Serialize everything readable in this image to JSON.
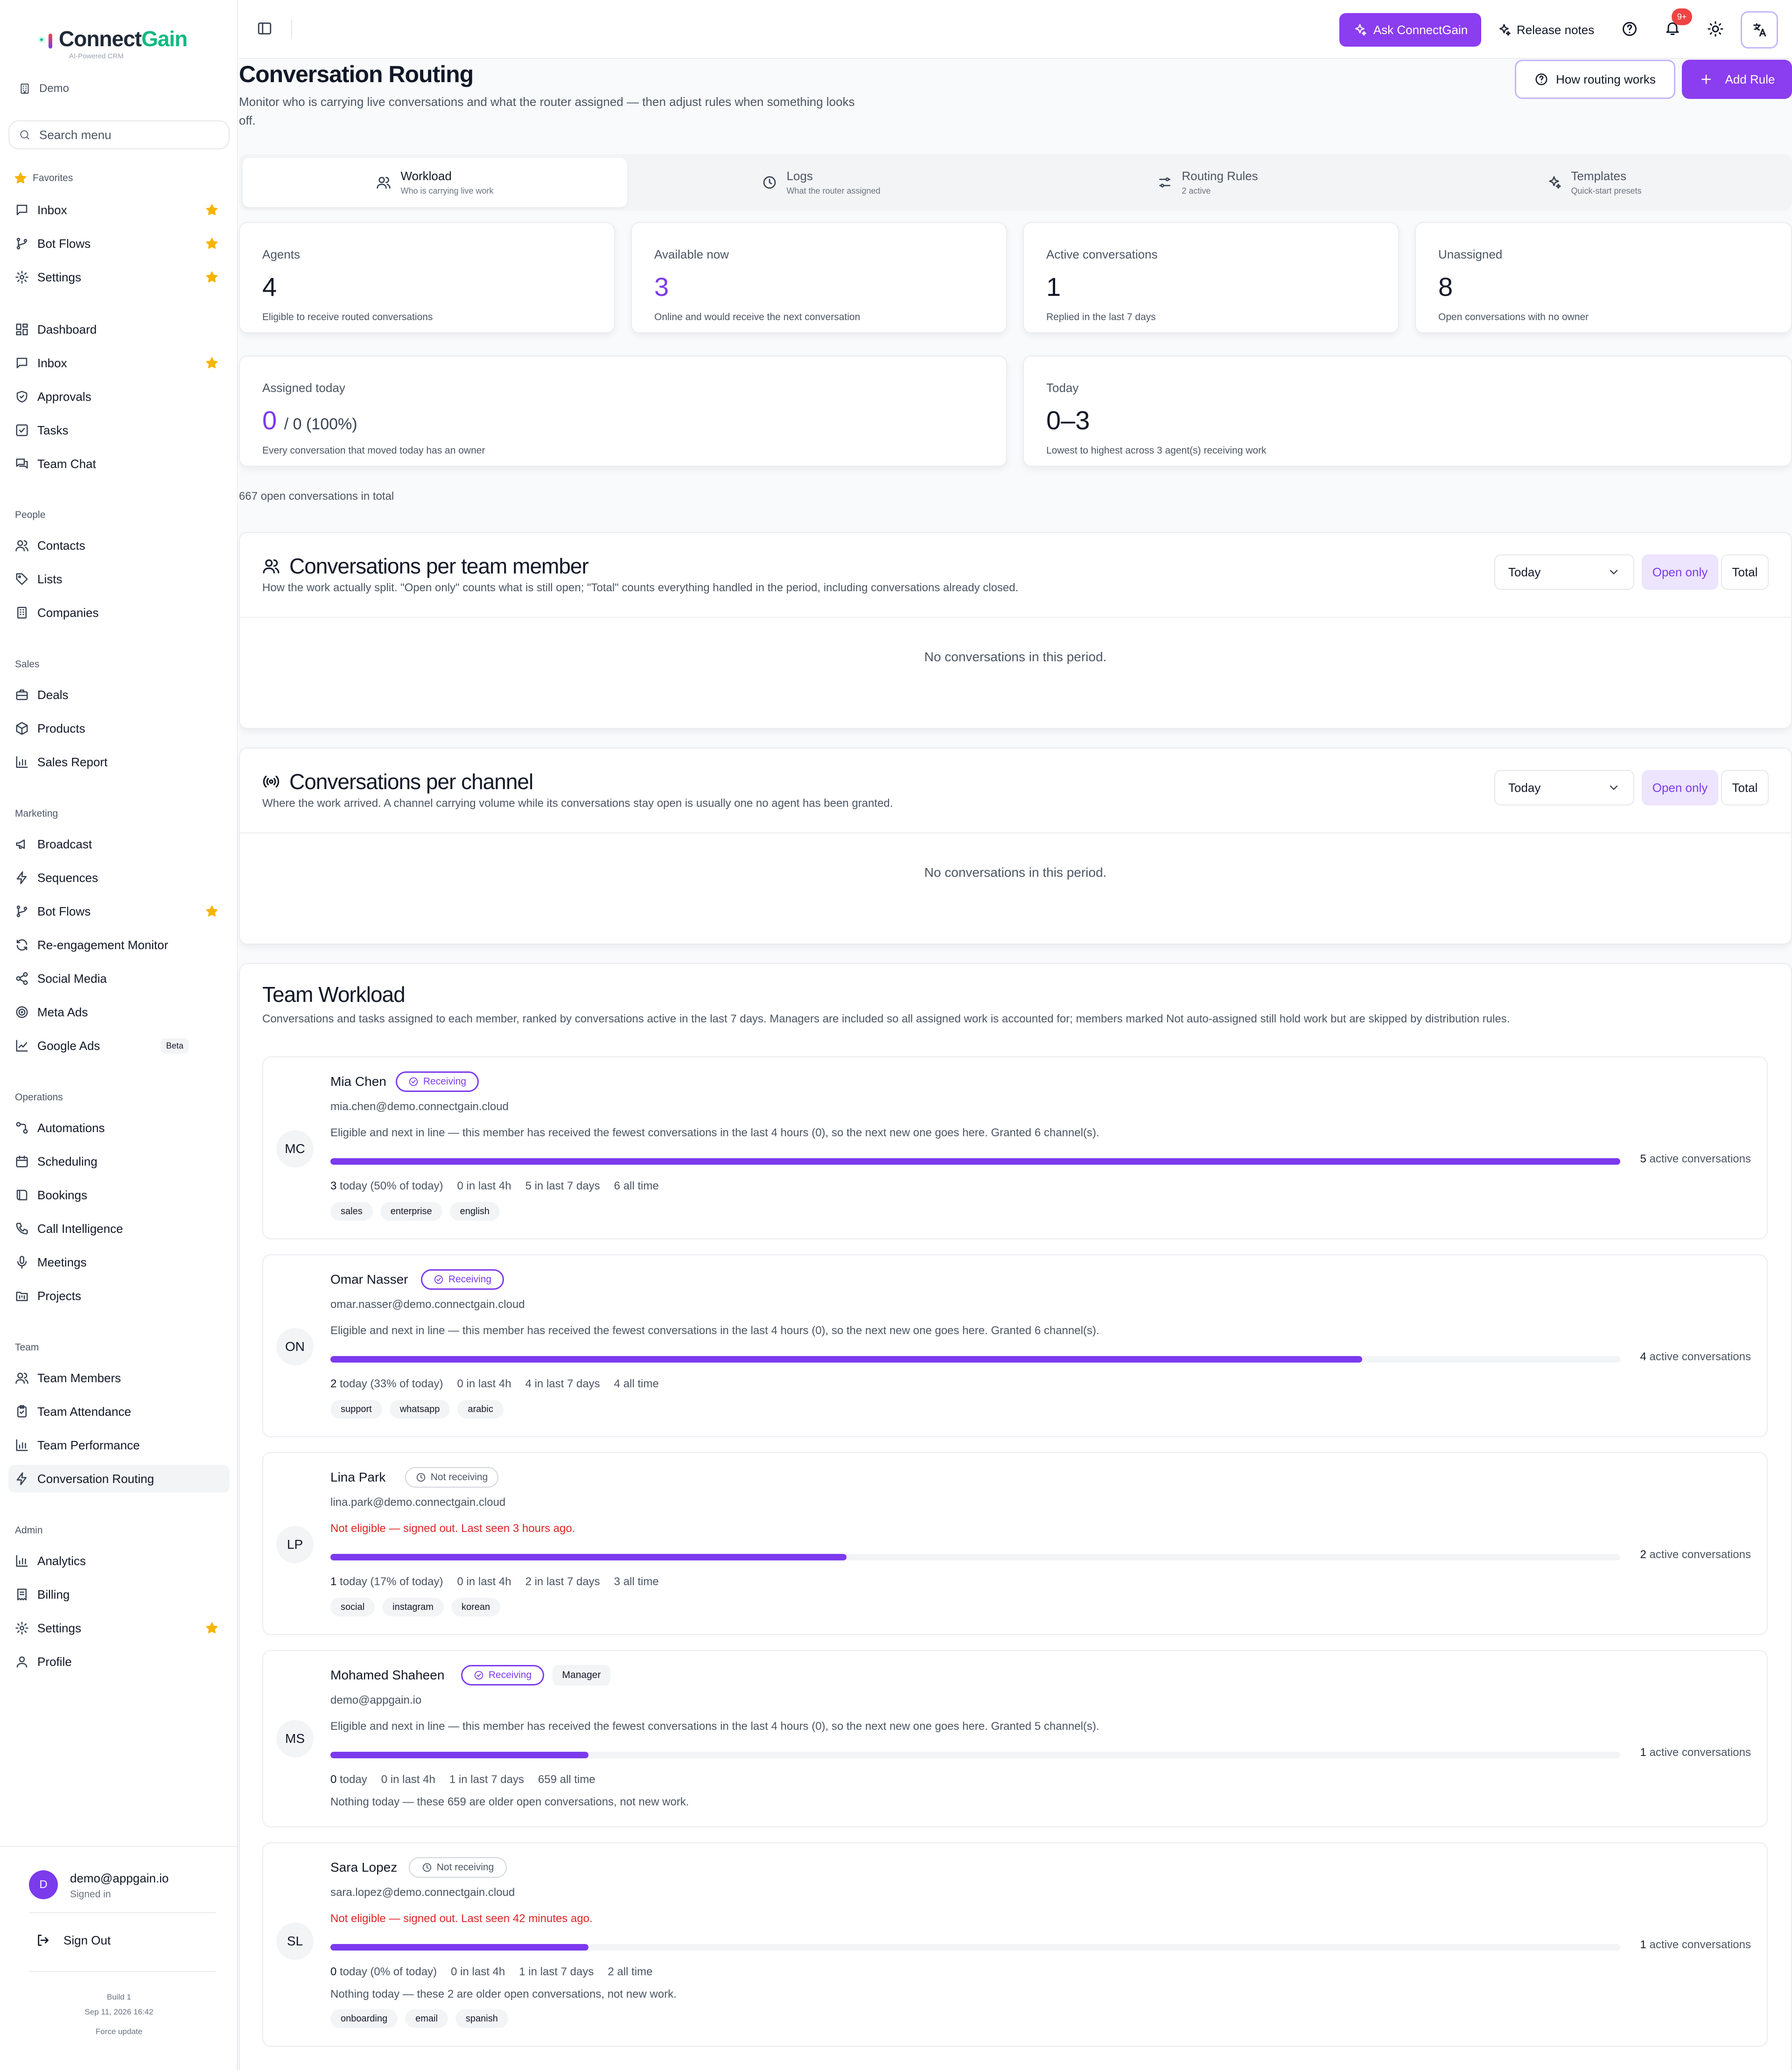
{
  "brand": {
    "name_a": "Connect",
    "name_b": "Gain",
    "tagline": "AI-Powered CRM"
  },
  "workspace": {
    "label": "Demo"
  },
  "search": {
    "placeholder": "Search menu"
  },
  "sidebar": {
    "favorites_label": "Favorites",
    "favorites": [
      "Inbox",
      "Bot Flows",
      "Settings"
    ],
    "main": [
      "Dashboard",
      "Inbox",
      "Approvals",
      "Tasks",
      "Team Chat"
    ],
    "people_label": "People",
    "people": [
      "Contacts",
      "Lists",
      "Companies"
    ],
    "sales_label": "Sales",
    "sales": [
      "Deals",
      "Products",
      "Sales Report"
    ],
    "marketing_label": "Marketing",
    "marketing": [
      "Broadcast",
      "Sequences",
      "Bot Flows",
      "Re-engagement Monitor",
      "Social Media",
      "Meta Ads",
      "Google Ads"
    ],
    "beta_label": "Beta",
    "operations_label": "Operations",
    "operations": [
      "Automations",
      "Scheduling",
      "Bookings",
      "Call Intelligence",
      "Meetings",
      "Projects"
    ],
    "team_label": "Team",
    "team": [
      "Team Members",
      "Team Attendance",
      "Team Performance",
      "Conversation Routing"
    ],
    "admin_label": "Admin",
    "admin": [
      "Analytics",
      "Billing",
      "Settings",
      "Profile"
    ]
  },
  "user": {
    "initial": "D",
    "email": "demo@appgain.io",
    "status": "Signed in",
    "sign_out": "Sign Out"
  },
  "build": {
    "label": "Build 1",
    "date": "Sep 11, 2026 16:42",
    "force": "Force update"
  },
  "topbar": {
    "ask": "Ask ConnectGain",
    "release": "Release notes",
    "notif_badge": "9+"
  },
  "page": {
    "title": "Conversation Routing",
    "subtitle": "Monitor who is carrying live conversations and what the router assigned — then adjust rules when something looks off.",
    "how_btn": "How routing works",
    "add_btn": "Add Rule"
  },
  "tabs": [
    {
      "label": "Workload",
      "sub": "Who is carrying live work"
    },
    {
      "label": "Logs",
      "sub": "What the router assigned"
    },
    {
      "label": "Routing Rules",
      "sub": "2 active"
    },
    {
      "label": "Templates",
      "sub": "Quick-start presets"
    }
  ],
  "stats": [
    {
      "label": "Agents",
      "value": "4",
      "note": "Eligible to receive routed conversations"
    },
    {
      "label": "Available now",
      "value": "3",
      "note": "Online and would receive the next conversation"
    },
    {
      "label": "Active conversations",
      "value": "1",
      "note": "Replied in the last 7 days"
    },
    {
      "label": "Unassigned",
      "value": "8",
      "note": "Open conversations with no owner"
    }
  ],
  "assigned": {
    "label": "Assigned today",
    "value": "0",
    "rest": "/ 0 (100%)",
    "note": "Every conversation that moved today has an owner"
  },
  "today": {
    "label": "Today",
    "value": "0–3",
    "note": "Lowest to highest across 3 agent(s) receiving work"
  },
  "open_total": "667 open conversations in total",
  "per_member": {
    "title": "Conversations per team member",
    "subtitle": "How the work actually split. \"Open only\" counts what is still open; \"Total\" counts everything handled in the period, including conversations already closed.",
    "period": "Today",
    "open_only": "Open only",
    "total": "Total",
    "empty": "No conversations in this period."
  },
  "per_channel": {
    "title": "Conversations per channel",
    "subtitle": "Where the work arrived. A channel carrying volume while its conversations stay open is usually one no agent has been granted.",
    "period": "Today",
    "open_only": "Open only",
    "total": "Total",
    "empty": "No conversations in this period."
  },
  "team_workload": {
    "title": "Team Workload",
    "subtitle": "Conversations and tasks assigned to each member, ranked by conversations active in the last 7 days. Managers are included so all assigned work is accounted for; members marked Not auto-assigned still hold work but are skipped by distribution rules.",
    "active_suffix": "active conversations",
    "members": [
      {
        "initials": "MC",
        "name": "Mia Chen",
        "status": "Receiving",
        "email": "mia.chen@demo.connectgain.cloud",
        "eligibility": "Eligible and next in line — this member has received the fewest conversations in the last 4 hours (0), so the next new one goes here. Granted 6 channel(s).",
        "active": "5",
        "load": 1.0,
        "today_n": "3",
        "today_rest": "today (50% of today)",
        "last4h": "0 in last 4h",
        "last7d": "5 in last 7 days",
        "alltime": "6 all time",
        "tags": [
          "sales",
          "enterprise",
          "english"
        ]
      },
      {
        "initials": "ON",
        "name": "Omar Nasser",
        "status": "Receiving",
        "email": "omar.nasser@demo.connectgain.cloud",
        "eligibility": "Eligible and next in line — this member has received the fewest conversations in the last 4 hours (0), so the next new one goes here. Granted 6 channel(s).",
        "active": "4",
        "load": 0.8,
        "today_n": "2",
        "today_rest": "today (33% of today)",
        "last4h": "0 in last 4h",
        "last7d": "4 in last 7 days",
        "alltime": "4 all time",
        "tags": [
          "support",
          "whatsapp",
          "arabic"
        ]
      },
      {
        "initials": "LP",
        "name": "Lina Park",
        "status": "Not receiving",
        "email": "lina.park@demo.connectgain.cloud",
        "eligibility": "Not eligible — signed out. Last seen 3 hours ago.",
        "active": "2",
        "load": 0.4,
        "today_n": "1",
        "today_rest": "today (17% of today)",
        "last4h": "0 in last 4h",
        "last7d": "2 in last 7 days",
        "alltime": "3 all time",
        "tags": [
          "social",
          "instagram",
          "korean"
        ]
      },
      {
        "initials": "MS",
        "name": "Mohamed Shaheen",
        "status": "Receiving",
        "role": "Manager",
        "email": "demo@appgain.io",
        "eligibility": "Eligible and next in line — this member has received the fewest conversations in the last 4 hours (0), so the next new one goes here. Granted 5 channel(s).",
        "active": "1",
        "load": 0.2,
        "today_n": "0",
        "today_rest": "today",
        "last4h": "0 in last 4h",
        "last7d": "1 in last 7 days",
        "alltime": "659 all time",
        "note": "Nothing today — these 659 are older open conversations, not new work."
      },
      {
        "initials": "SL",
        "name": "Sara Lopez",
        "status": "Not receiving",
        "email": "sara.lopez@demo.connectgain.cloud",
        "eligibility": "Not eligible — signed out. Last seen 42 minutes ago.",
        "active": "1",
        "load": 0.2,
        "today_n": "0",
        "today_rest": "today (0% of today)",
        "last4h": "0 in last 4h",
        "last7d": "1 in last 7 days",
        "alltime": "2 all time",
        "note": "Nothing today — these 2 are older open conversations, not new work.",
        "tags": [
          "onboarding",
          "email",
          "spanish"
        ]
      }
    ]
  },
  "colors": {
    "accent": "#7c3aed",
    "accent_btn": "#8b3df0",
    "brand_green": "#10b981",
    "danger": "#dc2626",
    "star": "#f5b400"
  }
}
